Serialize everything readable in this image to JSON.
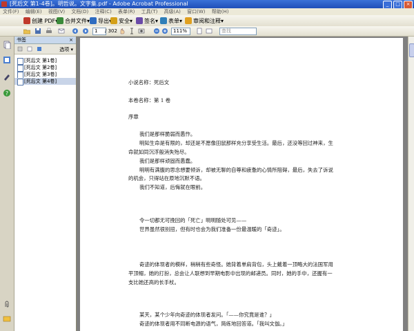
{
  "window": {
    "title": "[死后文 第1-4卷]。明哲说。文字集.pdf - Adobe Acrobat Professional",
    "min": "_",
    "max": "□",
    "close": "×"
  },
  "menu": [
    "文件(F)",
    "编辑(E)",
    "视图(V)",
    "文档(D)",
    "注释(C)",
    "表单(R)",
    "工具(T)",
    "高级(A)",
    "窗口(W)",
    "帮助(H)"
  ],
  "toolbar": {
    "create_pdf": "创建 PDF",
    "combine": "合并文件",
    "export": "导出",
    "secure": "安全",
    "sign": "签名",
    "forms": "表单",
    "review": "审阅和注释"
  },
  "nav": {
    "page_current": "1",
    "page_total": "/ 302",
    "zoom": "111%",
    "find_placeholder": "查找"
  },
  "panel": {
    "title": "书签",
    "close": "×",
    "options": "选项",
    "bookmarks": [
      "[死后文 第1卷]",
      "[死后文 第2卷]",
      "[死后文 第3卷]",
      "[死后文 第4卷]"
    ]
  },
  "document": {
    "lines": [
      {
        "text": "小说名称：死后文",
        "indent": false
      },
      {
        "text": "本卷名称：第 1 卷",
        "indent": false
      },
      {
        "text": "序章",
        "indent": false
      },
      {
        "text": "我们是那样脆弱而愚怍。",
        "indent": true
      },
      {
        "text": "明知生命是有限的，却还是不愿像田鼠那样充分享受生活。最后，还没等回过神来，生",
        "indent": true
      },
      {
        "text": "命就如同沉浮般消失殆尽。",
        "indent": false
      },
      {
        "text": "我们是那样顽固而愚蠢。",
        "indent": true
      },
      {
        "text": "明明有满腹的思念想要倾诉，却被无聊的自尊和疲惫的心情所阻碍，最后，失去了诉说",
        "indent": true
      },
      {
        "text": "的机会，只得站在原地沉默不语。",
        "indent": false
      },
      {
        "text": "我们不知道，后悔就在眼前。",
        "indent": true
      },
      {
        "text": "令一切都无可挽回的「死亡」明明随处可见——",
        "indent": true
      },
      {
        "text": "世界虽然很别扭，但有时也会为我们准备一份最温暖的「奇迹」。",
        "indent": true
      },
      {
        "text": "奇迹的体现者的模样，稍稍有些奇怪。她背着单肩背包，头上戴着一顶略大的法国军用",
        "indent": true
      },
      {
        "text": "平顶帽，她的打扮，总会让人联想到早期电影中出现的邮递员。同时，她的手中，还握有一",
        "indent": false
      },
      {
        "text": "支比她还高的长手杖。",
        "indent": false
      },
      {
        "text": "某天，某个少年向奇迹的体现者发问。「——你究竟是谁？」",
        "indent": true
      },
      {
        "text": "奇迹的体现者用不同断电源的语气，简练地回答道。「我叫文伽。」",
        "indent": true
      },
      {
        "text": "",
        "indent": false
      }
    ]
  },
  "colors": {
    "accent": "#1f4fb8",
    "panel_head": "#c8d8ec",
    "page_bg": "#808080"
  }
}
